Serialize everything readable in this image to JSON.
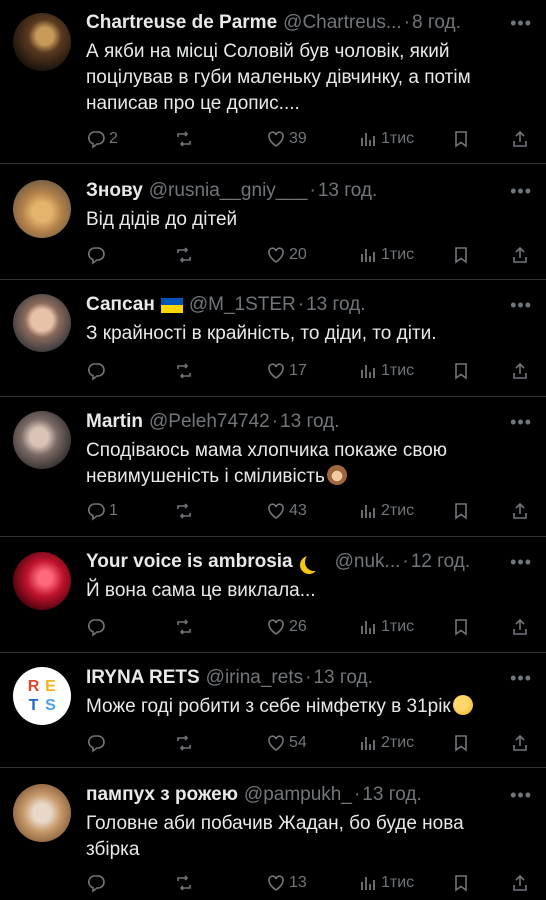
{
  "tweets": [
    {
      "name": "Chartreuse de Parme",
      "handle": "@Chartreus...",
      "time": "8 год.",
      "text_lines": [
        "А якби на місці Соловій був чоловік, який",
        "поцілував в губи маленьку дівчинку, а потім",
        "написав про це допис...."
      ],
      "replies": "2",
      "retweets": "",
      "likes": "39",
      "views": "1тис"
    },
    {
      "name": "Знову",
      "handle": "@rusnia__gniy___",
      "time": "13 год.",
      "text_lines": [
        "Від дідів до дітей"
      ],
      "replies": "",
      "retweets": "",
      "likes": "20",
      "views": "1тис"
    },
    {
      "name": "Сапсан",
      "handle": "@M_1STER",
      "time": "13 год.",
      "text_lines": [
        "З крайності в крайність, то діди, то діти."
      ],
      "replies": "",
      "retweets": "",
      "likes": "17",
      "views": "1тис"
    },
    {
      "name": "Martin",
      "handle": "@Peleh74742",
      "time": "13 год.",
      "text_lines": [
        "Сподіваюсь мама хлопчика покаже свою",
        "невимушеність і сміливість"
      ],
      "replies": "1",
      "retweets": "",
      "likes": "43",
      "views": "2тис"
    },
    {
      "name": "Your voice is ambrosia",
      "handle": "@nuk...",
      "time": "12 год.",
      "text_lines": [
        "Й вона сама це виклала..."
      ],
      "replies": "",
      "retweets": "",
      "likes": "26",
      "views": "1тис"
    },
    {
      "name": "IRYNA RETS",
      "handle": "@irina_rets",
      "time": "13 год.",
      "text_lines": [
        "Може годі робити з себе німфетку в 31рік"
      ],
      "replies": "",
      "retweets": "",
      "likes": "54",
      "views": "2тис"
    },
    {
      "name": "пампух з рожею",
      "handle": "@pampukh_",
      "time": "13 год.",
      "text_lines": [
        "Головне аби побачив Жадан, бо буде нова",
        "збірка"
      ],
      "replies": "",
      "retweets": "",
      "likes": "13",
      "views": "1тис"
    }
  ],
  "avatar_rets_letters": [
    "R",
    "E",
    "T",
    "S"
  ],
  "more_glyph": "•••",
  "dot": "·",
  "colors": {
    "background": "#000000",
    "text": "#e7e9ea",
    "muted": "#71767b",
    "divider": "#2f3336"
  }
}
